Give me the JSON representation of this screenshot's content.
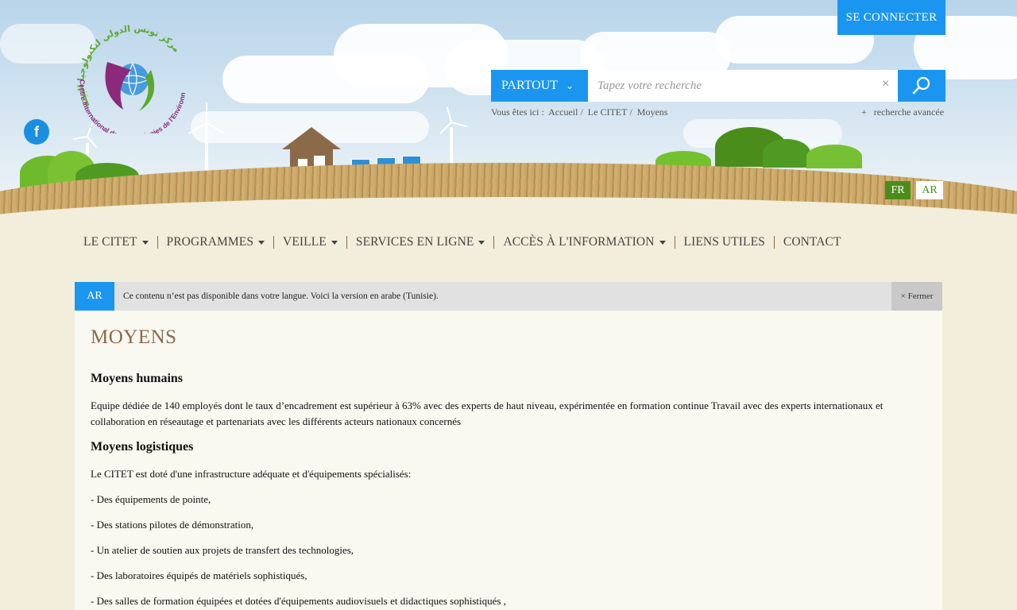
{
  "header": {
    "login_label": "SE CONNECTER",
    "facebook_label": "f",
    "logo_text_fr": "Centre International des Technologies de l'Environnement de Tunis",
    "logo_text_ar": "مركز تونس الدولي لتكنولوجيا البيئة"
  },
  "search": {
    "scope_label": "PARTOUT",
    "placeholder": "Tapez votre recherche",
    "clear_label": "×",
    "advanced_label": "+   recherche avancée"
  },
  "breadcrumb": {
    "prefix": "Vous êtes ici :",
    "items": [
      "Accueil",
      "Le CITET",
      "Moyens"
    ],
    "separator": "/"
  },
  "languages": {
    "fr": "FR",
    "ar": "AR",
    "active": "FR"
  },
  "nav": {
    "items": [
      {
        "label": "LE CITET",
        "dropdown": true
      },
      {
        "label": "PROGRAMMES",
        "dropdown": true
      },
      {
        "label": "VEILLE",
        "dropdown": true
      },
      {
        "label": "SERVICES EN LIGNE",
        "dropdown": true
      },
      {
        "label": "ACCÈS À L'INFORMATION",
        "dropdown": true
      },
      {
        "label": "LIENS UTILES",
        "dropdown": false
      },
      {
        "label": "CONTACT",
        "dropdown": false
      }
    ]
  },
  "notice": {
    "tag": "AR",
    "message": "Ce contenu n’est pas disponible dans votre langue. Voici la version en arabe (Tunisie).",
    "close_label": "× Fermer"
  },
  "content": {
    "title": "MOYENS",
    "section1_title": "Moyens humains",
    "section1_text": "Equipe dédiée de 140 employés dont le taux d’encadrement est supérieur à 63% avec des experts de haut niveau, expérimentée en formation continue Travail avec des experts internationaux et collaboration en réseautage et partenariats avec les différents acteurs nationaux concernés",
    "section2_title": "Moyens logistiques",
    "section2_intro": "Le CITET est doté d'une infrastructure adéquate et d'équipements spécialisés:",
    "section2_items": [
      "- Des équipements de pointe,",
      "- Des stations pilotes de démonstration,",
      "- Un atelier de soutien aux projets de transfert des technologies,",
      "- Des laboratoires équipés de matériels sophistiqués,",
      "- Des salles de formation équipées et dotées d'équipements audiovisuels et didactiques sophistiqués ,"
    ]
  },
  "colors": {
    "accent_blue": "#1a96f0",
    "brand_green": "#4b8d1b",
    "title_brown": "#8b6a4a"
  }
}
